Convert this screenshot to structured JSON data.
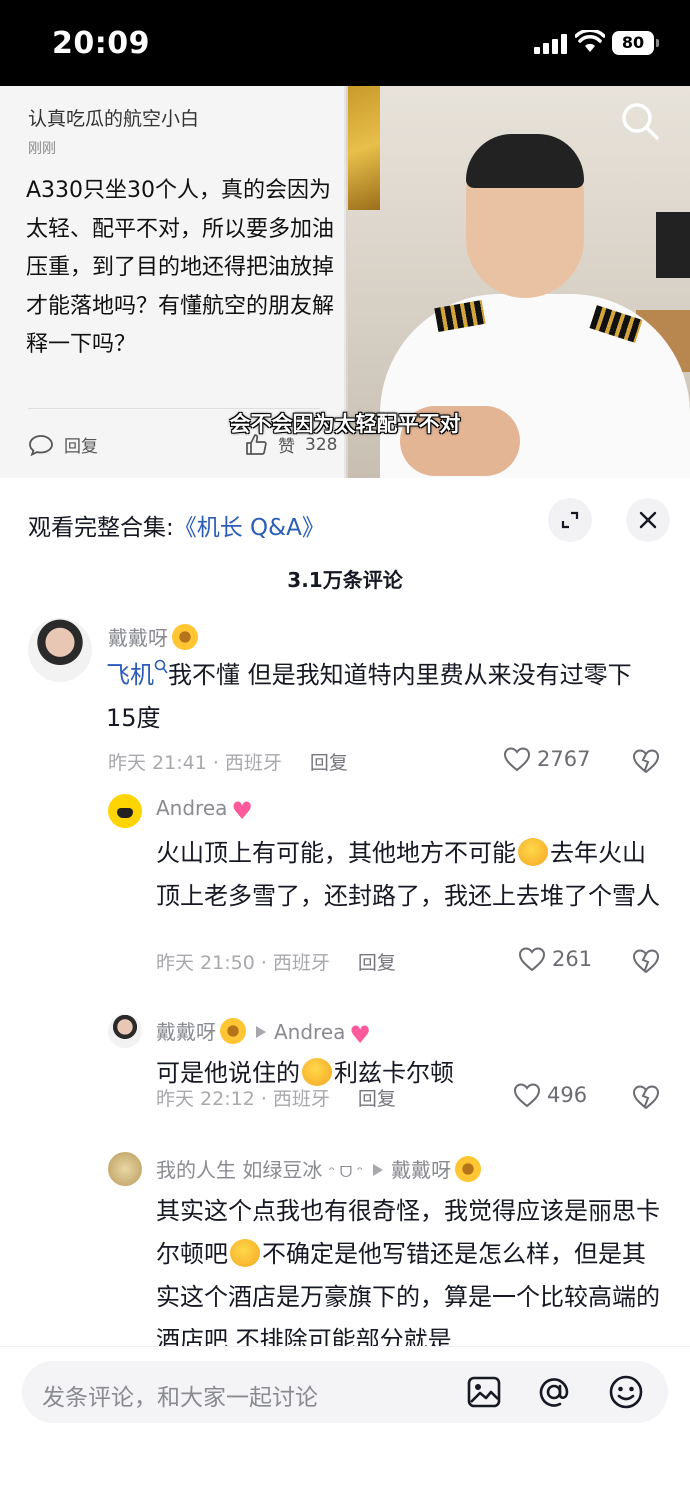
{
  "status": {
    "time": "20:09",
    "battery": "80"
  },
  "video": {
    "card": {
      "user": "认真吃瓜的航空小白",
      "time": "刚刚",
      "text": "A330只坐30个人，真的会因为太轻、配平不对，所以要多加油压重，到了目的地还得把油放掉才能落地吗？有懂航空的朋友解释一下吗？",
      "reply_label": "回复",
      "like_label": "赞",
      "like_count": "328"
    },
    "subtitle": "会不会因为太轻配平不对"
  },
  "comments_panel": {
    "collection_prefix": "观看完整合集:",
    "collection_link": "《机长 Q&A》",
    "count": "3.1万条评论",
    "comments": [
      {
        "user": "戴戴呀",
        "search_word": "飞机",
        "text": "我不懂 但是我知道特内里费从来没有过零下15度",
        "meta": "昨天 21:41 · 西班牙",
        "reply": "回复",
        "likes": "2767"
      },
      {
        "user": "Andrea",
        "text_a": "火山顶上有可能，其他地方不可能",
        "text_b": "去年火山顶上老多雪了，还封路了，我还上去堆了个雪人",
        "meta": "昨天 21:50 · 西班牙",
        "reply": "回复",
        "likes": "261"
      },
      {
        "user": "戴戴呀",
        "reply_to": "Andrea",
        "text_a": "可是他说住的",
        "text_b": "利兹卡尔顿",
        "meta": "昨天 22:12 · 西班牙",
        "reply": "回复",
        "likes": "496"
      },
      {
        "user": "我的人生 如绿豆冰",
        "user_suffix": "ᵔ ᗜ ᵔ",
        "reply_to": "戴戴呀",
        "text_a": "其实这个点我也有很奇怪，我觉得应该是丽思卡尔顿吧",
        "text_b": "不确定是他写错还是怎么样，但是其实这个酒店是万豪旗下的，算是一个比较高端的酒店吧 不排除可能部分就是"
      }
    ]
  },
  "input": {
    "placeholder": "发条评论，和大家一起讨论"
  }
}
